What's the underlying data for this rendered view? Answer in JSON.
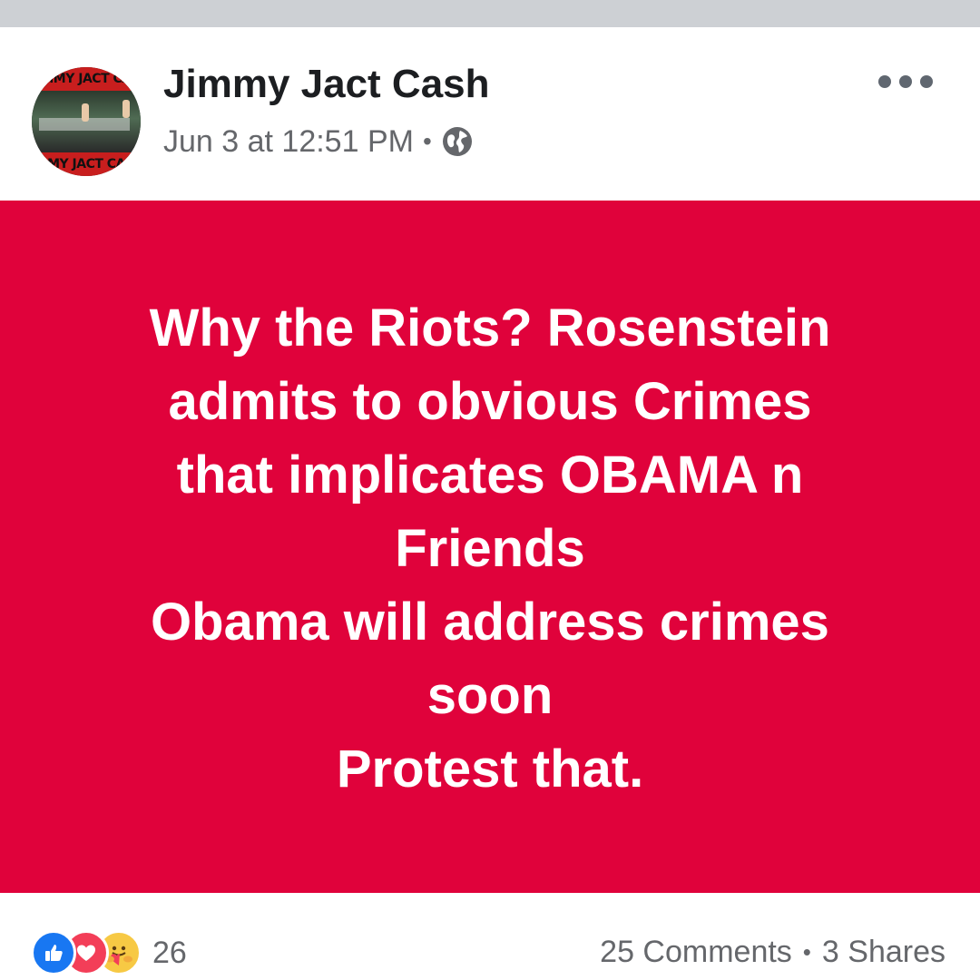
{
  "post": {
    "author": "Jimmy Jact Cash",
    "timestamp": "Jun 3 at 12:51 PM",
    "meta_separator": "•",
    "privacy_icon": "globe-icon",
    "more_icon": "more-options-icon",
    "avatar": {
      "top_text": "MMY JACT CA",
      "bottom_text": "MY JACT CA"
    }
  },
  "banner": {
    "background_color": "#e0023b",
    "text_color": "#ffffff",
    "lines": [
      "Why the Riots? Rosenstein",
      "admits to obvious Crimes",
      "that implicates OBAMA n",
      "Friends",
      "Obama will address crimes",
      "soon",
      "Protest that."
    ]
  },
  "footer": {
    "reaction_icons": [
      "like-icon",
      "love-icon",
      "care-icon"
    ],
    "reaction_count": "26",
    "comments": "25 Comments",
    "separator": "•",
    "shares": "3 Shares"
  },
  "colors": {
    "top_strip": "#cdd0d4",
    "secondary_text": "#65676b",
    "like_blue": "#1877f2",
    "love_red": "#f33e58",
    "care_yellow": "#f7c944"
  }
}
